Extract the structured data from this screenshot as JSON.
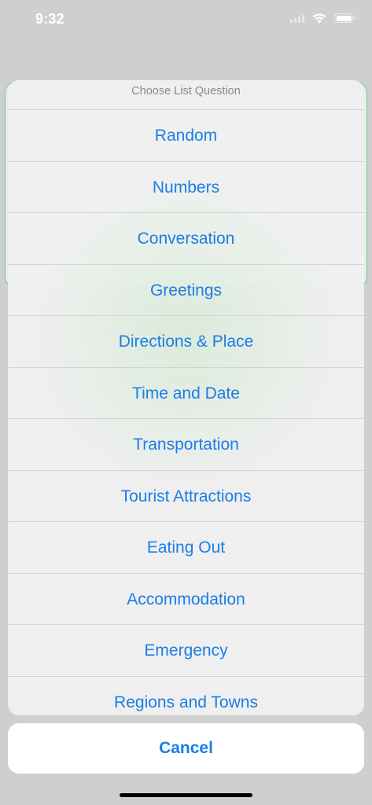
{
  "status_bar": {
    "time": "9:32"
  },
  "action_sheet": {
    "title": "Choose List Question",
    "options": [
      {
        "label": "Random"
      },
      {
        "label": "Numbers"
      },
      {
        "label": "Conversation"
      },
      {
        "label": "Greetings"
      },
      {
        "label": "Directions & Place"
      },
      {
        "label": "Time and Date"
      },
      {
        "label": "Transportation"
      },
      {
        "label": "Tourist Attractions"
      },
      {
        "label": "Eating Out"
      },
      {
        "label": "Accommodation"
      },
      {
        "label": "Emergency"
      },
      {
        "label": "Regions and Towns"
      }
    ],
    "cancel_label": "Cancel"
  },
  "colors": {
    "accent": "#1a7ee6",
    "card_border": "#7cc48a",
    "dim_background": "#cfcfcf"
  }
}
